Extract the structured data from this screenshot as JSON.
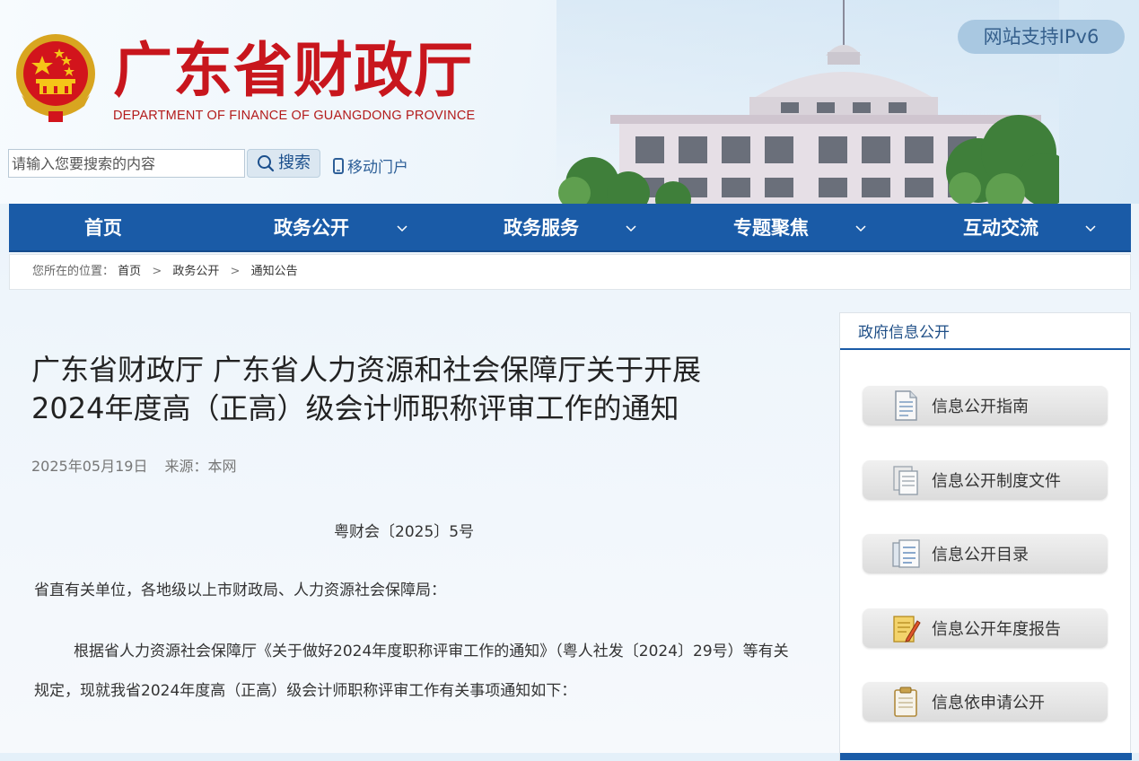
{
  "header": {
    "logo_cn": "广东省财政厅",
    "logo_en": "DEPARTMENT OF FINANCE OF GUANGDONG PROVINCE",
    "ipv6_badge": "网站支持IPv6",
    "search_placeholder": "请输入您要搜索的内容",
    "search_button": "搜索",
    "mobile_portal": "移动门户"
  },
  "nav": {
    "items": [
      {
        "label": "首页"
      },
      {
        "label": "政务公开"
      },
      {
        "label": "政务服务"
      },
      {
        "label": "专题聚焦"
      },
      {
        "label": "互动交流"
      }
    ]
  },
  "breadcrumb": {
    "prefix": "您所在的位置：",
    "items": [
      "首页",
      "政务公开",
      "通知公告"
    ]
  },
  "article": {
    "title_line1": "广东省财政厅 广东省人力资源和社会保障厅关于开展",
    "title_line2": "2024年度高（正高）级会计师职称评审工作的通知",
    "date": "2025年05月19日",
    "source": "来源：本网",
    "doc_number": "粤财会〔2025〕5号",
    "salutation": "省直有关单位，各地级以上市财政局、人力资源社会保障局：",
    "body": "根据省人力资源社会保障厅《关于做好2024年度职称评审工作的通知》（粤人社发〔2024〕29号）等有关规定，现就我省2024年度高（正高）级会计师职称评审工作有关事项通知如下："
  },
  "sidebar": {
    "title": "政府信息公开",
    "items": [
      {
        "label": "信息公开指南",
        "icon": "document-icon"
      },
      {
        "label": "信息公开制度文件",
        "icon": "files-icon"
      },
      {
        "label": "信息公开目录",
        "icon": "folder-list-icon"
      },
      {
        "label": "信息公开年度报告",
        "icon": "report-pencil-icon"
      },
      {
        "label": "信息依申请公开",
        "icon": "clipboard-icon"
      }
    ]
  },
  "colors": {
    "nav_blue": "#1a5ba7",
    "logo_red": "#c8161d",
    "ipv6_bg": "#a9c8e1"
  }
}
